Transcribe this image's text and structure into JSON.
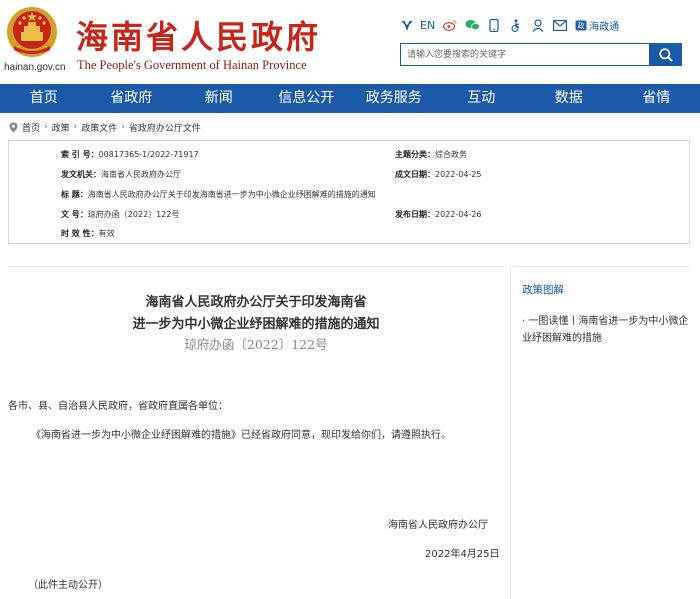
{
  "header": {
    "title_cn": "海南省人民政府",
    "title_en": "The People's Government  of  Hainan Province",
    "domain": "hainan.gov.cn",
    "lang_en": "EN",
    "hzw_label": "海政通",
    "search_placeholder": "请输入您要搜索的关键字",
    "brand_color": "#c9241a",
    "accent_color": "#1a5aa8"
  },
  "nav": [
    {
      "label": "首页"
    },
    {
      "label": "省政府"
    },
    {
      "label": "新闻"
    },
    {
      "label": "信息公开"
    },
    {
      "label": "政务服务"
    },
    {
      "label": "互动"
    },
    {
      "label": "数据"
    },
    {
      "label": "省情"
    }
  ],
  "breadcrumb": [
    "首页",
    "政策",
    "政策文件",
    "省政府办公厅文件"
  ],
  "meta": {
    "index_label": "索 引 号：",
    "index_value": "00817365-1/2022-71917",
    "topic_label": "主题分类：",
    "topic_value": "综合政务",
    "issuer_label": "发文机关：",
    "issuer_value": "海南省人民政府办公厅",
    "created_label": "成文日期：",
    "created_value": "2022-04-25",
    "title_label": "标 题：",
    "title_value": "海南省人民政府办公厅关于印发海南省进一步为中小微企业纾困解难的措施的通知",
    "docnum_label": "文 号：",
    "docnum_value": "琼府办函〔2022〕122号",
    "published_label": "发布日期：",
    "published_value": "2022-04-26",
    "validity_label": "时 效 性：",
    "validity_value": "有效"
  },
  "article": {
    "title_line1": "海南省人民政府办公厅关于印发海南省",
    "title_line2": "进一步为中小微企业纾困解难的措施的通知",
    "doc_number": "琼府办函〔2022〕122号",
    "greeting": "各市、县、自治县人民政府，省政府直属各单位：",
    "body": "《海南省进一步为中小微企业纾困解难的措施》已经省政府同意，现印发给你们，请遵照执行。",
    "signature": "海南省人民政府办公厅",
    "date": "2022年4月25日",
    "note": "（此件主动公开）"
  },
  "sidebar": {
    "title": "政策图解",
    "link": "· 一图读懂丨海南省进一步为中小微企业纾困解难的措施"
  }
}
